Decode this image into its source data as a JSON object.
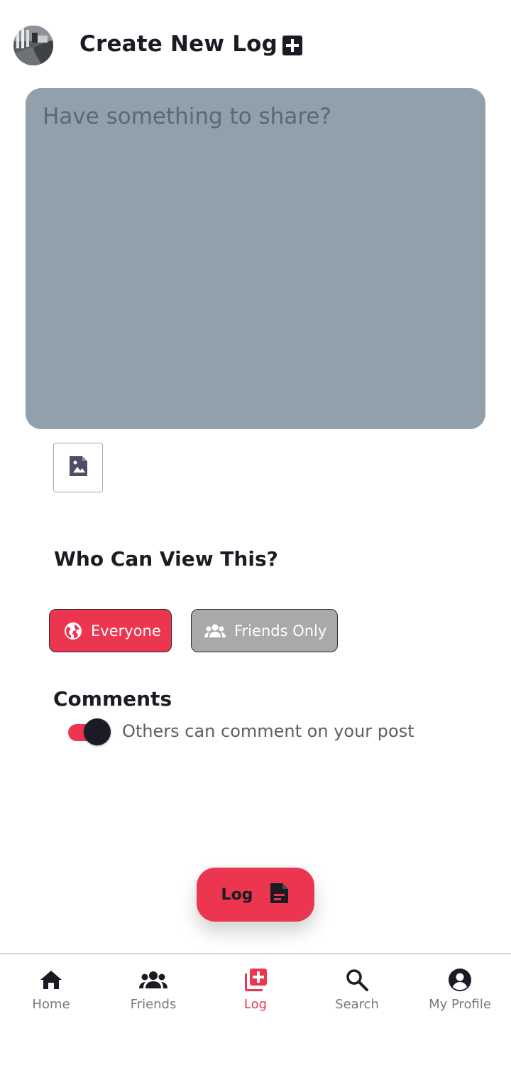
{
  "header": {
    "title": "Create New Log",
    "add_icon": "add-box-icon",
    "avatar": "user-avatar-photo"
  },
  "composer": {
    "placeholder": "Have something to share?",
    "value": "",
    "image_button_icon": "add-image-icon"
  },
  "visibility": {
    "title": "Who Can View This?",
    "options": [
      {
        "label": "Everyone",
        "icon": "globe-icon",
        "selected": true
      },
      {
        "label": "Friends Only",
        "icon": "group-icon",
        "selected": false
      }
    ]
  },
  "comments": {
    "title": "Comments",
    "toggle_on": true,
    "label": "Others can comment on your post"
  },
  "log_button": {
    "label": "Log",
    "icon": "document-icon"
  },
  "nav": {
    "items": [
      {
        "label": "Home",
        "icon": "home-icon",
        "active": false
      },
      {
        "label": "Friends",
        "icon": "people-icon",
        "active": false
      },
      {
        "label": "Log",
        "icon": "add-library-icon",
        "active": true
      },
      {
        "label": "Search",
        "icon": "search-icon",
        "active": false
      },
      {
        "label": "My Profile",
        "icon": "account-circle-icon",
        "active": false
      }
    ]
  },
  "colors": {
    "accent": "#ec3650",
    "text_dark": "#1c1b24",
    "composer_bg": "#91a0ab",
    "chip_inactive": "#a9a9a9",
    "nav_inactive": "#7a7a7a"
  }
}
